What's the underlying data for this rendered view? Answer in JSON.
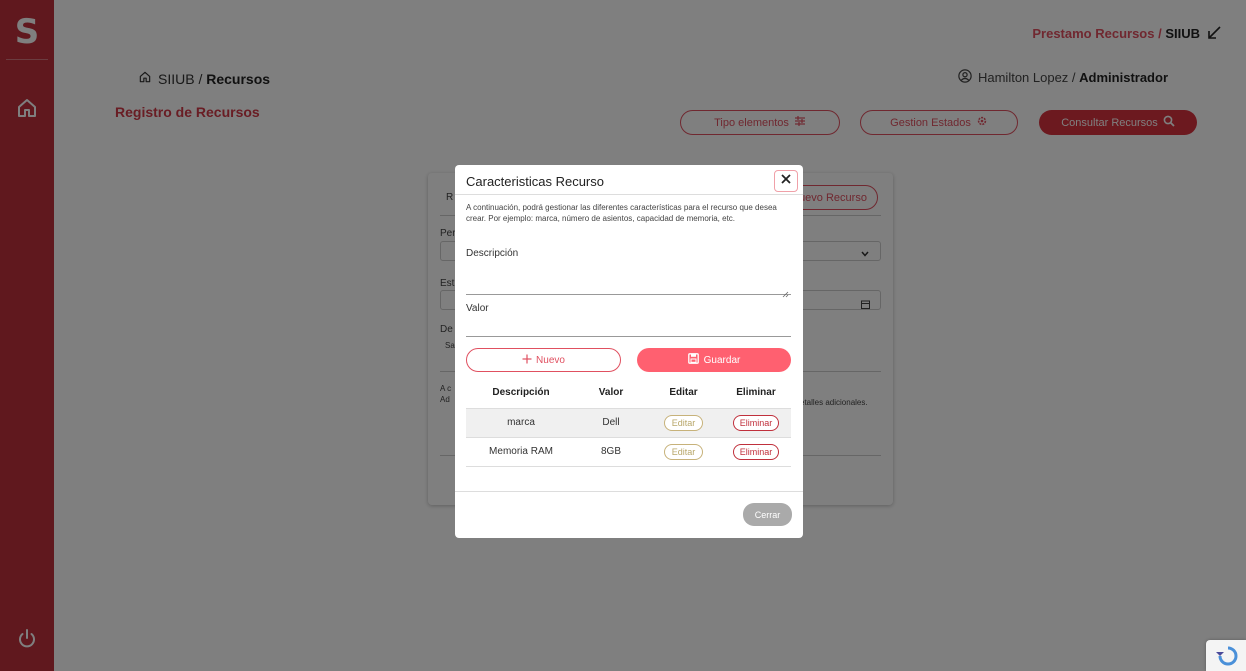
{
  "sidebar": {
    "logo_letter": "S"
  },
  "topbar": {
    "app_name": "Prestamo Recursos",
    "separator": " / ",
    "system_name": "SIIUB"
  },
  "breadcrumb": {
    "root": "SIIUB",
    "separator": " / ",
    "current": "Recursos"
  },
  "user": {
    "name": "Hamilton Lopez",
    "separator": " / ",
    "role": "Administrador"
  },
  "page_title": "Registro de Recursos",
  "toolbar": {
    "tipo_elementos": "Tipo elementos",
    "gestion_estados": "Gestion Estados",
    "consultar_recursos": "Consultar Recursos"
  },
  "background_form": {
    "nuevo_recurso": "uevo Recurso",
    "frag_r": "R",
    "frag_per": "Per",
    "frag_est": "Est",
    "frag_de": "De",
    "frag_sa": "Sa",
    "frag_a": "A c",
    "frag_ad": "Ad",
    "detalles": "etalles adicionales."
  },
  "modal": {
    "title": "Caracteristicas Recurso",
    "description": "A continuación, podrá gestionar las diferentes características para el recurso que desea crear. Por ejemplo: marca, número de asientos, capacidad de memoria, etc.",
    "descripcion_label": "Descripción",
    "valor_label": "Valor",
    "btn_nuevo": "Nuevo",
    "btn_guardar": "Guardar",
    "table": {
      "headers": [
        "Descripción",
        "Valor",
        "Editar",
        "Eliminar"
      ],
      "rows": [
        {
          "descripcion": "marca",
          "valor": "Dell",
          "editar": "Editar",
          "eliminar": "Eliminar"
        },
        {
          "descripcion": "Memoria RAM",
          "valor": "8GB",
          "editar": "Editar",
          "eliminar": "Eliminar"
        }
      ]
    },
    "btn_cerrar": "Cerrar"
  },
  "colors": {
    "brand": "#c0303c",
    "accent": "#e05060",
    "guardar": "#ff6070"
  }
}
